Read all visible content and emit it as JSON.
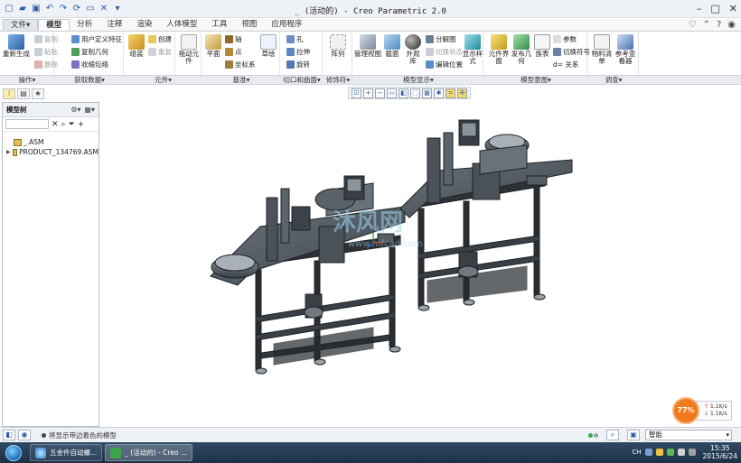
{
  "window": {
    "title": "_ (活动的) - Creo Parametric 2.0"
  },
  "menu_tabs": [
    {
      "label": "文件▾",
      "active": false
    },
    {
      "label": "模型",
      "active": true
    },
    {
      "label": "分析",
      "active": false
    },
    {
      "label": "注释",
      "active": false
    },
    {
      "label": "渲染",
      "active": false
    },
    {
      "label": "人体模型",
      "active": false
    },
    {
      "label": "工具",
      "active": false
    },
    {
      "label": "视图",
      "active": false
    },
    {
      "label": "应用程序",
      "active": false
    }
  ],
  "ribbon": {
    "regenerate": "重新生成",
    "copy": "复制",
    "paste": "粘贴",
    "delete": "删除",
    "user_feature": "用户定义特征",
    "copy_geometry": "复制几何",
    "shrinkwrap": "收缩包络",
    "assemble": "组装",
    "create": "创建",
    "repeat": "重复",
    "drag_components": "拖动元件",
    "plane": "平面",
    "axis": "轴",
    "point": "点",
    "coord_sys": "坐标系",
    "sketch": "草绘",
    "hole": "孔",
    "extrude": "拉伸",
    "revolve": "旋转",
    "pattern": "阵列",
    "manage_views": "管理视图",
    "section": "截面",
    "appearance": "外观库",
    "exploded_view": "分解图",
    "toggle_state": "切换状态",
    "edit_position": "编辑位置",
    "display_style": "显示样式",
    "component_interface": "元件界面",
    "publish_geometry": "发布几何",
    "relations_tbl": "族表",
    "parameters": "参数",
    "switch_symbol": "切换符号",
    "relations": "d= 关系",
    "bom": "物料清单",
    "reference_viewer": "参考查看器"
  },
  "ribbon_groups": [
    "操作▾",
    "获取数据▾",
    "元件▾",
    "基准▾",
    "切口和曲面▾",
    "修饰符▾",
    "模型显示▾",
    "模型意图▾",
    "调查▾"
  ],
  "navigator": {
    "header": "模型树",
    "tree": [
      {
        "label": "_.ASM",
        "expandable": false
      },
      {
        "label": "PRODUCT_134769.ASM",
        "expandable": true
      }
    ]
  },
  "viewport": {
    "watermark_text": "沐风网",
    "watermark_url": "www.mfcad.com"
  },
  "status": {
    "message": "将显示带边着色的模型",
    "filter": "智能"
  },
  "speed_widget": {
    "percent": "77%",
    "up": "1.1K/s",
    "down": "1.1K/s"
  },
  "taskbar": {
    "tasks": [
      {
        "label": "五金件自动螺...",
        "active": false
      },
      {
        "label": "_ (活动的) - Creo ...",
        "active": true
      }
    ],
    "lang": "CH",
    "time": "15:35",
    "date": "2015/6/24"
  }
}
